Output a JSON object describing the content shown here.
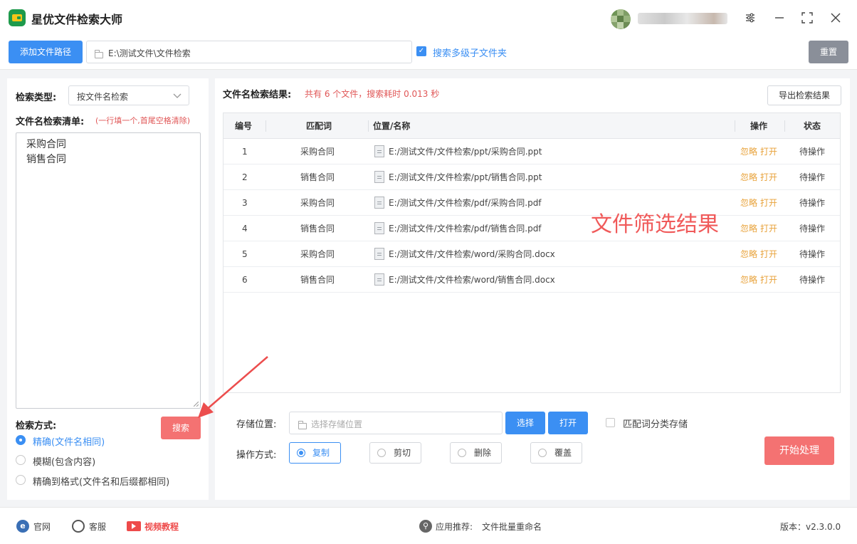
{
  "app": {
    "title": "星优文件检索大师"
  },
  "toolbar": {
    "add_path_label": "添加文件路径",
    "path_value": "E:\\测试文件\\文件检索",
    "subfolder_label": "搜索多级子文件夹",
    "subfolder_checked": true,
    "reset_label": "重置"
  },
  "left": {
    "search_type_label": "检索类型:",
    "search_type_value": "按文件名检索",
    "list_label": "文件名检索清单:",
    "list_hint": "(一行填一个,首尾空格清除)",
    "list_items": [
      "采购合同",
      "销售合同"
    ],
    "mode_label": "检索方式:",
    "modes": [
      {
        "label": "精确(文件名相同)",
        "selected": true
      },
      {
        "label": "模糊(包含内容)",
        "selected": false
      },
      {
        "label": "精确到格式(文件名和后缀都相同)",
        "selected": false
      }
    ],
    "search_button": "搜索"
  },
  "results": {
    "title": "文件名检索结果:",
    "summary": "共有 6 个文件，搜索耗时 0.013 秒",
    "export_button": "导出检索结果",
    "columns": {
      "no": "编号",
      "keyword": "匹配词",
      "path": "位置/名称",
      "action": "操作",
      "status": "状态"
    },
    "rows": [
      {
        "no": "1",
        "keyword": "采购合同",
        "path": "E:/测试文件/文件检索/ppt/采购合同.ppt",
        "ignore": "忽略",
        "open": "打开",
        "status": "待操作"
      },
      {
        "no": "2",
        "keyword": "销售合同",
        "path": "E:/测试文件/文件检索/ppt/销售合同.ppt",
        "ignore": "忽略",
        "open": "打开",
        "status": "待操作"
      },
      {
        "no": "3",
        "keyword": "采购合同",
        "path": "E:/测试文件/文件检索/pdf/采购合同.pdf",
        "ignore": "忽略",
        "open": "打开",
        "status": "待操作"
      },
      {
        "no": "4",
        "keyword": "销售合同",
        "path": "E:/测试文件/文件检索/pdf/销售合同.pdf",
        "ignore": "忽略",
        "open": "打开",
        "status": "待操作"
      },
      {
        "no": "5",
        "keyword": "采购合同",
        "path": "E:/测试文件/文件检索/word/采购合同.docx",
        "ignore": "忽略",
        "open": "打开",
        "status": "待操作"
      },
      {
        "no": "6",
        "keyword": "销售合同",
        "path": "E:/测试文件/文件检索/word/销售合同.docx",
        "ignore": "忽略",
        "open": "打开",
        "status": "待操作"
      }
    ],
    "overlay_text": "文件筛选结果"
  },
  "bottom": {
    "storage_label": "存储位置:",
    "storage_placeholder": "选择存储位置",
    "choose_button": "选择",
    "open_button": "打开",
    "classify_label": "匹配词分类存储",
    "op_label": "操作方式:",
    "ops": [
      {
        "label": "复制",
        "selected": true
      },
      {
        "label": "剪切",
        "selected": false
      },
      {
        "label": "删除",
        "selected": false
      },
      {
        "label": "覆盖",
        "selected": false
      }
    ],
    "start_button": "开始处理"
  },
  "footer": {
    "website": "官网",
    "service": "客服",
    "video": "视频教程",
    "recommend_label": "应用推荐:",
    "recommend_value": "文件批量重命名",
    "version": "版本：v2.3.0.0"
  },
  "colors": {
    "accent": "#3b8ff3",
    "danger": "#f47272",
    "action": "#e8a23a",
    "overlay": "#f05a5a"
  }
}
